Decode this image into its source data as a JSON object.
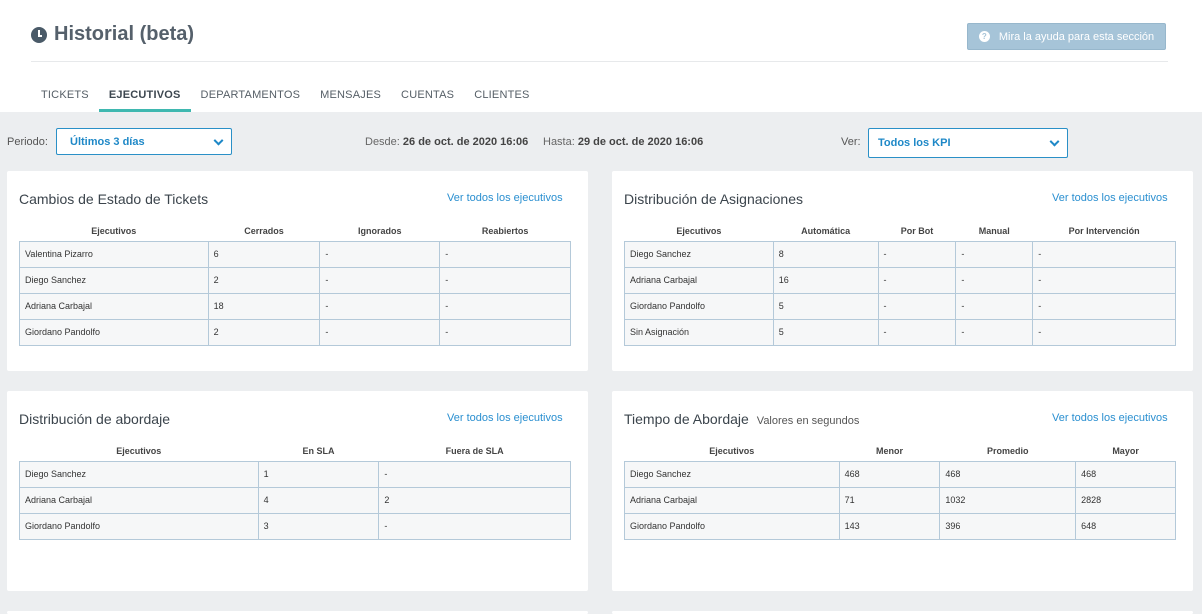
{
  "header": {
    "title": "Historial (beta)",
    "help_label": "Mira la ayuda para esta sección"
  },
  "tabs": [
    {
      "label": "TICKETS"
    },
    {
      "label": "EJECUTIVOS"
    },
    {
      "label": "DEPARTAMENTOS"
    },
    {
      "label": "MENSAJES"
    },
    {
      "label": "CUENTAS"
    },
    {
      "label": "CLIENTES"
    }
  ],
  "active_tab": "EJECUTIVOS",
  "filters": {
    "periodo_label": "Periodo:",
    "periodo_value": "Últimos 3 días",
    "desde_label": "Desde:",
    "desde_value": "26 de oct. de 2020 16:06",
    "hasta_label": "Hasta:",
    "hasta_value": "29 de oct. de 2020 16:06",
    "ver_label": "Ver:",
    "ver_value": "Todos los KPI"
  },
  "colors": {
    "accent": "#1e88c7",
    "tab_underline": "#3fb8b0",
    "help_button": "#a6c4d8",
    "link": "#2a8fd0"
  },
  "cards": {
    "estado": {
      "title": "Cambios de Estado de Tickets",
      "link": "Ver todos los ejecutivos",
      "headers": [
        "Ejecutivos",
        "Cerrados",
        "Ignorados",
        "Reabiertos"
      ],
      "rows": [
        [
          "Valentina Pizarro",
          "6",
          "-",
          "-"
        ],
        [
          "Diego Sanchez",
          "2",
          "-",
          "-"
        ],
        [
          "Adriana Carbajal",
          "18",
          "-",
          "-"
        ],
        [
          "Giordano Pandolfo",
          "2",
          "-",
          "-"
        ]
      ]
    },
    "asignaciones": {
      "title": "Distribución de Asignaciones",
      "link": "Ver todos los ejecutivos",
      "headers": [
        "Ejecutivos",
        "Automática",
        "Por Bot",
        "Manual",
        "Por Intervención"
      ],
      "rows": [
        [
          "Diego Sanchez",
          "8",
          "-",
          "-",
          "-"
        ],
        [
          "Adriana Carbajal",
          "16",
          "-",
          "-",
          "-"
        ],
        [
          "Giordano Pandolfo",
          "5",
          "-",
          "-",
          "-"
        ],
        [
          "Sin Asignación",
          "5",
          "-",
          "-",
          "-"
        ]
      ]
    },
    "abordaje": {
      "title": "Distribución de abordaje",
      "link": "Ver todos los ejecutivos",
      "headers": [
        "Ejecutivos",
        "En SLA",
        "Fuera de SLA"
      ],
      "rows": [
        [
          "Diego Sanchez",
          "1",
          "-"
        ],
        [
          "Adriana Carbajal",
          "4",
          "2"
        ],
        [
          "Giordano Pandolfo",
          "3",
          "-"
        ]
      ]
    },
    "tiempo": {
      "title": "Tiempo de Abordaje",
      "subtitle": "Valores en segundos",
      "link": "Ver todos los ejecutivos",
      "headers": [
        "Ejecutivos",
        "Menor",
        "Promedio",
        "Mayor"
      ],
      "rows": [
        [
          "Diego Sanchez",
          "468",
          "468",
          "468"
        ],
        [
          "Adriana Carbajal",
          "71",
          "1032",
          "2828"
        ],
        [
          "Giordano Pandolfo",
          "143",
          "396",
          "648"
        ]
      ]
    }
  }
}
